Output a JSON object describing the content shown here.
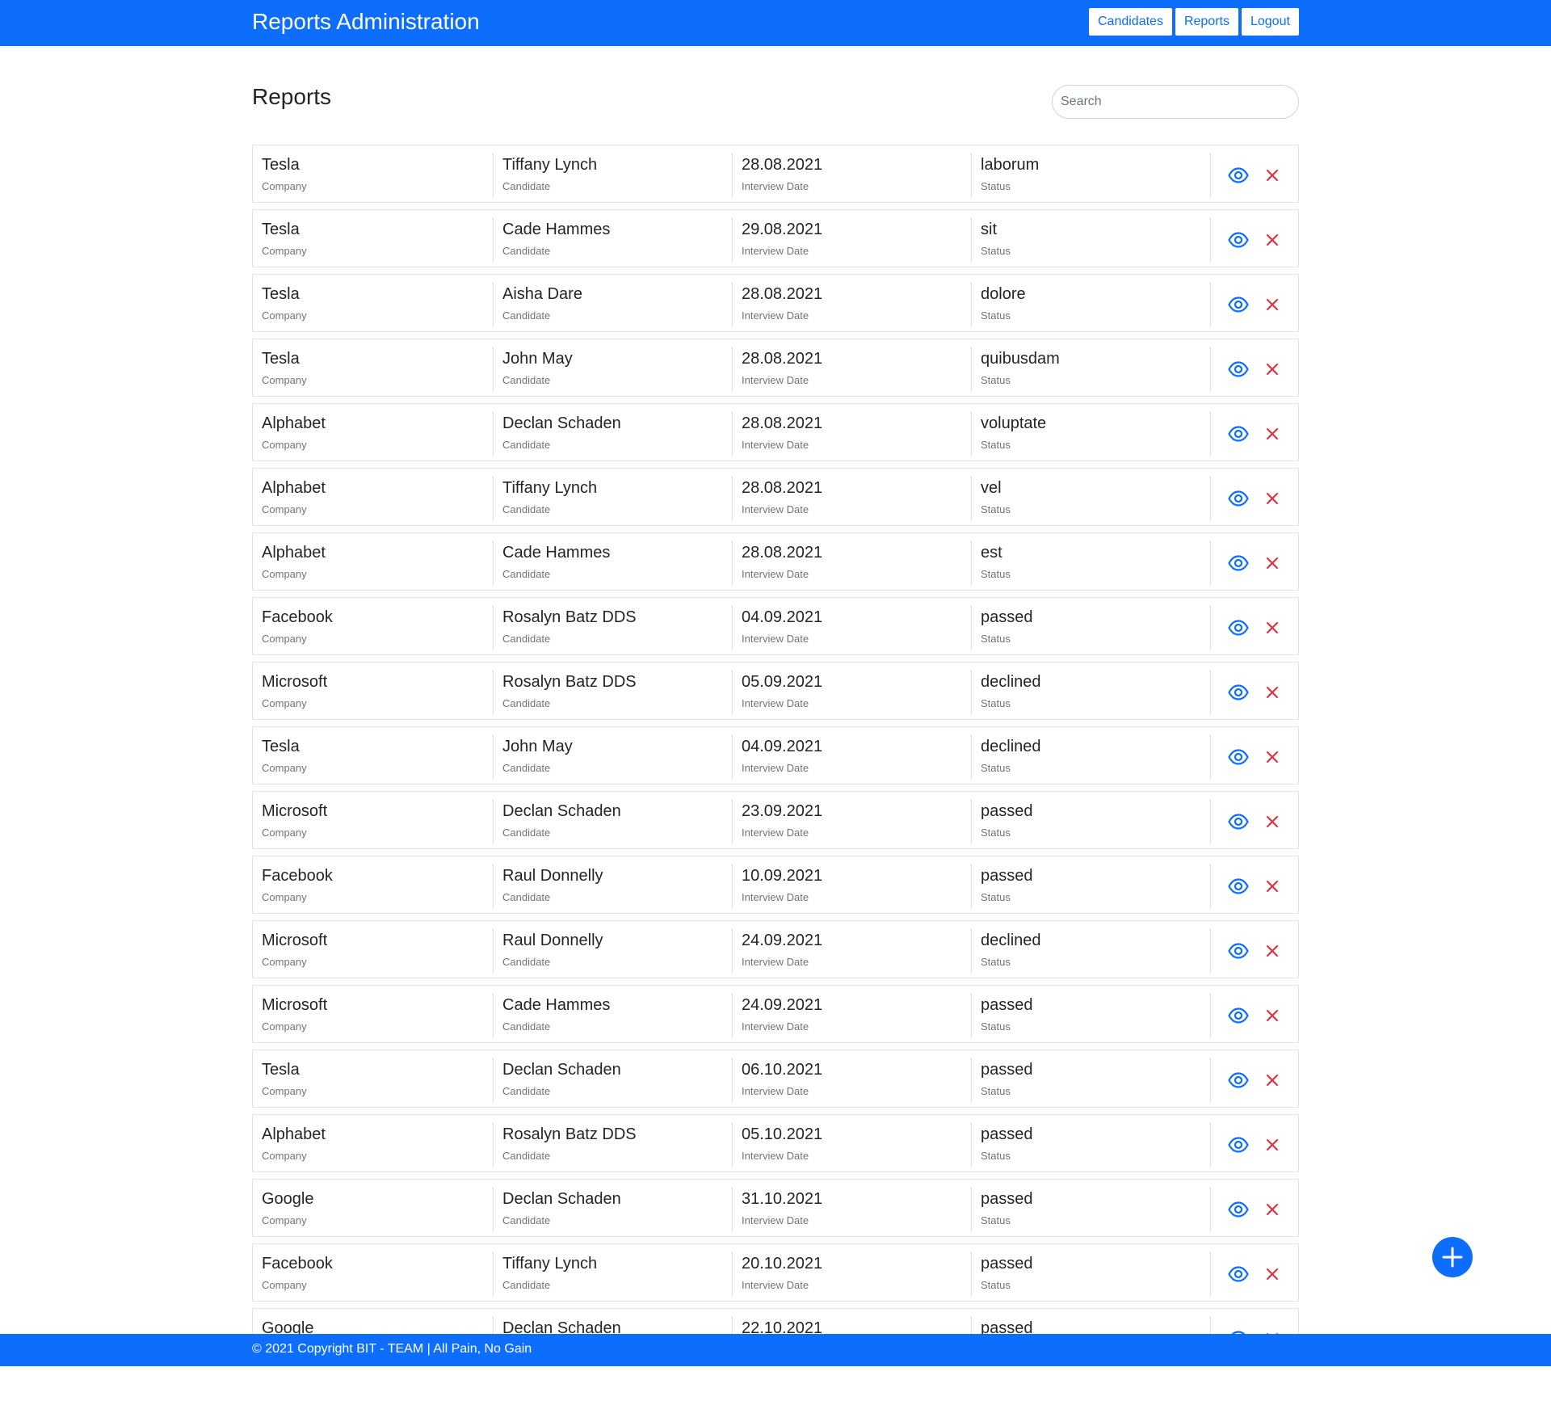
{
  "app": {
    "title": "Reports Administration"
  },
  "nav": {
    "candidates": "Candidates",
    "reports": "Reports",
    "logout": "Logout"
  },
  "page": {
    "title": "Reports"
  },
  "search": {
    "placeholder": "Search",
    "value": ""
  },
  "labels": {
    "company": "Company",
    "candidate": "Candidate",
    "interview_date": "Interview Date",
    "status": "Status"
  },
  "icons": {
    "view": "eye-icon",
    "delete": "close-icon",
    "add": "plus-icon"
  },
  "colors": {
    "primary": "#0d6efd",
    "danger": "#dc3545",
    "border": "#dee2e6",
    "muted": "#6c757d"
  },
  "reports": [
    {
      "company": "Tesla",
      "candidate": "Tiffany Lynch",
      "date": "28.08.2021",
      "status": "laborum"
    },
    {
      "company": "Tesla",
      "candidate": "Cade Hammes",
      "date": "29.08.2021",
      "status": "sit"
    },
    {
      "company": "Tesla",
      "candidate": "Aisha Dare",
      "date": "28.08.2021",
      "status": "dolore"
    },
    {
      "company": "Tesla",
      "candidate": "John May",
      "date": "28.08.2021",
      "status": "quibusdam"
    },
    {
      "company": "Alphabet",
      "candidate": "Declan Schaden",
      "date": "28.08.2021",
      "status": "voluptate"
    },
    {
      "company": "Alphabet",
      "candidate": "Tiffany Lynch",
      "date": "28.08.2021",
      "status": "vel"
    },
    {
      "company": "Alphabet",
      "candidate": "Cade Hammes",
      "date": "28.08.2021",
      "status": "est"
    },
    {
      "company": "Facebook",
      "candidate": "Rosalyn Batz DDS",
      "date": "04.09.2021",
      "status": "passed"
    },
    {
      "company": "Microsoft",
      "candidate": "Rosalyn Batz DDS",
      "date": "05.09.2021",
      "status": "declined"
    },
    {
      "company": "Tesla",
      "candidate": "John May",
      "date": "04.09.2021",
      "status": "declined"
    },
    {
      "company": "Microsoft",
      "candidate": "Declan Schaden",
      "date": "23.09.2021",
      "status": "passed"
    },
    {
      "company": "Facebook",
      "candidate": "Raul Donnelly",
      "date": "10.09.2021",
      "status": "passed"
    },
    {
      "company": "Microsoft",
      "candidate": "Raul Donnelly",
      "date": "24.09.2021",
      "status": "declined"
    },
    {
      "company": "Microsoft",
      "candidate": "Cade Hammes",
      "date": "24.09.2021",
      "status": "passed"
    },
    {
      "company": "Tesla",
      "candidate": "Declan Schaden",
      "date": "06.10.2021",
      "status": "passed"
    },
    {
      "company": "Alphabet",
      "candidate": "Rosalyn Batz DDS",
      "date": "05.10.2021",
      "status": "passed"
    },
    {
      "company": "Google",
      "candidate": "Declan Schaden",
      "date": "31.10.2021",
      "status": "passed"
    },
    {
      "company": "Facebook",
      "candidate": "Tiffany Lynch",
      "date": "20.10.2021",
      "status": "passed"
    },
    {
      "company": "Google",
      "candidate": "Declan Schaden",
      "date": "22.10.2021",
      "status": "passed"
    }
  ],
  "footer": {
    "text": "© 2021 Copyright BIT - TEAM | All Pain, No Gain"
  }
}
